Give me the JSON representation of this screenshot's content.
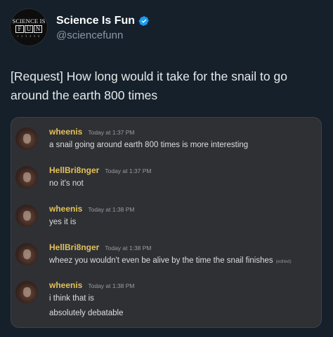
{
  "account": {
    "display_name": "Science Is Fun",
    "handle": "@sciencefunn",
    "logo": {
      "top": "SCIENCE IS",
      "letters": [
        "F",
        "U",
        "N"
      ],
      "bottom": "1 2 3 4 5 6"
    },
    "verified_icon": "verified-badge-icon",
    "verified_color": "#1d9bf0"
  },
  "tweet": {
    "text": "[Request] How long would it take for the snail to go around the earth 800 times"
  },
  "discord": {
    "author_color": "#e2c15a",
    "messages": [
      {
        "author": "wheenis",
        "time": "Today at 1:37 PM",
        "lines": [
          "a snail going around earth 800 times is more interesting"
        ]
      },
      {
        "author": "HellBri8nger",
        "time": "Today at 1:37 PM",
        "lines": [
          "no it's not"
        ]
      },
      {
        "author": "wheenis",
        "time": "Today at 1:38 PM",
        "lines": [
          "yes it is"
        ]
      },
      {
        "author": "HellBri8nger",
        "time": "Today at 1:38 PM",
        "lines": [
          "wheez you wouldn't even be alive by the time the snail finishes"
        ],
        "edited": "(edited)"
      },
      {
        "author": "wheenis",
        "time": "Today at 1:38 PM",
        "lines": [
          "i think that is",
          "absolutely debatable"
        ]
      }
    ]
  }
}
